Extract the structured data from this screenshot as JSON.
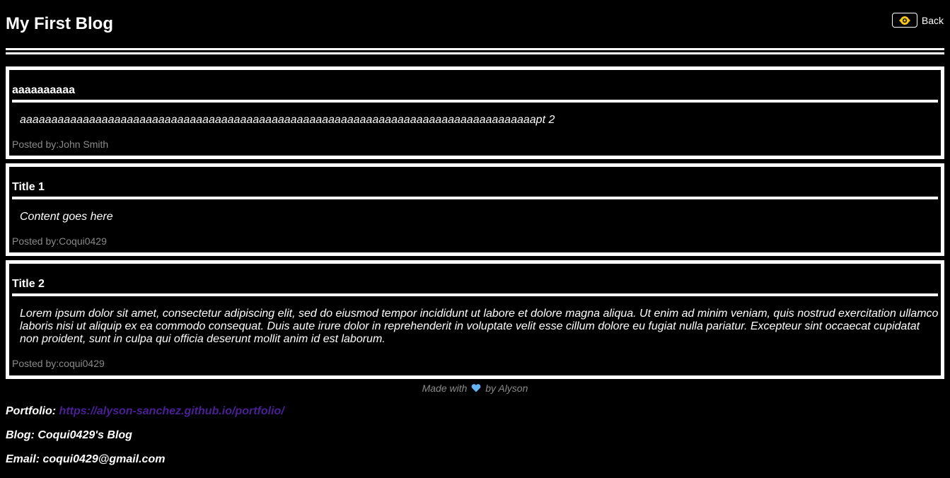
{
  "header": {
    "title": "My First Blog",
    "back_label": "Back"
  },
  "posts": [
    {
      "title": "aaaaaaaaaa",
      "content": "aaaaaaaaaaaaaaaaaaaaaaaaaaaaaaaaaaaaaaaaaaaaaaaaaaaaaaaaaaaaaaaaaaaaaaaaaaaaaaaaaapt 2",
      "author": "Posted by:John Smith"
    },
    {
      "title": "Title 1",
      "content": "Content goes here",
      "author": "Posted by:Coqui0429"
    },
    {
      "title": "Title 2",
      "content": "Lorem ipsum dolor sit amet, consectetur adipiscing elit, sed do eiusmod tempor incididunt ut labore et dolore magna aliqua. Ut enim ad minim veniam, quis nostrud exercitation ullamco laboris nisi ut aliquip ex ea commodo consequat. Duis aute irure dolor in reprehenderit in voluptate velit esse cillum dolore eu fugiat nulla pariatur. Excepteur sint occaecat cupidatat non proident, sunt in culpa qui officia deserunt mollit anim id est laborum.",
      "author": "Posted by:coqui0429"
    }
  ],
  "footer": {
    "made_prefix": "Made with",
    "made_suffix": "by Alyson",
    "heart_color": "#63b3f5",
    "portfolio_label": "Portfolio:",
    "portfolio_url": "https://alyson-sanchez.github.io/portfolio/",
    "blog_line": "Blog: Coqui0429's Blog",
    "email_line": "Email: coqui0429@gmail.com"
  },
  "colors": {
    "background": "#000000",
    "text": "#ffffff",
    "muted": "#8a8a8a",
    "link": "#4b1f96",
    "back_icon": "#f5c518"
  }
}
